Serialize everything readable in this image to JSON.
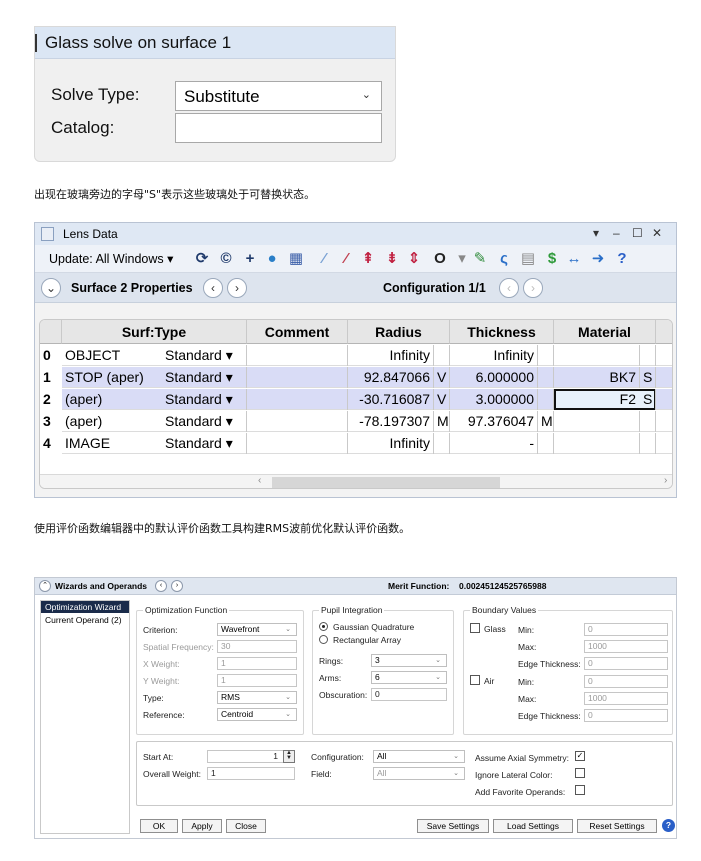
{
  "glass_solve": {
    "title": "Glass solve on surface 1",
    "solve_type_label": "Solve Type:",
    "solve_type_value": "Substitute",
    "catalog_label": "Catalog:",
    "catalog_value": ""
  },
  "caption1": "出现在玻璃旁边的字母\"S\"表示这些玻璃处于可替换状态。",
  "lens_data": {
    "title": "Lens Data",
    "update_label": "Update: All Windows ▾",
    "surface_label": "Surface  2 Properties",
    "config_label": "Configuration 1/1",
    "headers": [
      "Surf:Type",
      "Comment",
      "Radius",
      "Thickness",
      "Material"
    ],
    "rows": [
      {
        "num": "0",
        "name": "OBJECT",
        "type": "Standard ▾",
        "comment": "",
        "radius": "Infinity",
        "rflag": "",
        "thick": "Infinity",
        "tflag": "",
        "mat": "",
        "mflag": ""
      },
      {
        "num": "1",
        "name": "STOP (aper)",
        "type": "Standard ▾",
        "comment": "",
        "radius": "92.847066",
        "rflag": "V",
        "thick": "6.000000",
        "tflag": "",
        "mat": "BK7",
        "mflag": "S"
      },
      {
        "num": "2",
        "name": "(aper)",
        "type": "Standard ▾",
        "comment": "",
        "radius": "-30.716087",
        "rflag": "V",
        "thick": "3.000000",
        "tflag": "",
        "mat": "F2",
        "mflag": "S"
      },
      {
        "num": "3",
        "name": "(aper)",
        "type": "Standard ▾",
        "comment": "",
        "radius": "-78.197307",
        "rflag": "M",
        "thick": "97.376047",
        "tflag": "M",
        "mat": "",
        "mflag": ""
      },
      {
        "num": "4",
        "name": "IMAGE",
        "type": "Standard ▾",
        "comment": "",
        "radius": "Infinity",
        "rflag": "",
        "thick": "-",
        "tflag": "",
        "mat": "",
        "mflag": ""
      }
    ]
  },
  "caption2": "使用评价函数编辑器中的默认评价函数工具构建RMS波前优化默认评价函数。",
  "wizard": {
    "title": "Wizards and Operands",
    "merit_label": "Merit Function:",
    "merit_value": "0.00245124525765988",
    "sidebar": [
      "Optimization Wizard",
      "Current Operand (2)"
    ],
    "opt_func": {
      "title": "Optimization Function",
      "criterion_label": "Criterion:",
      "criterion": "Wavefront",
      "spatial_label": "Spatial Frequency:",
      "spatial": "30",
      "xw_label": "X Weight:",
      "xw": "1",
      "yw_label": "Y Weight:",
      "yw": "1",
      "type_label": "Type:",
      "type": "RMS",
      "ref_label": "Reference:",
      "ref": "Centroid"
    },
    "pupil": {
      "title": "Pupil Integration",
      "gq": "Gaussian Quadrature",
      "ra": "Rectangular Array",
      "rings_label": "Rings:",
      "rings": "3",
      "arms_label": "Arms:",
      "arms": "6",
      "obs_label": "Obscuration:",
      "obs": "0"
    },
    "boundary": {
      "title": "Boundary Values",
      "glass": "Glass",
      "air": "Air",
      "min_label": "Min:",
      "max_label": "Max:",
      "edge_label": "Edge Thickness:",
      "g_min": "0",
      "g_max": "1000",
      "g_edge": "0",
      "a_min": "0",
      "a_max": "1000",
      "a_edge": "0"
    },
    "bottom": {
      "start_label": "Start At:",
      "start": "1",
      "weight_label": "Overall Weight:",
      "weight": "1",
      "config_label": "Configuration:",
      "config": "All",
      "field_label": "Field:",
      "field": "All",
      "axial": "Assume Axial Symmetry:",
      "lateral": "Ignore Lateral Color:",
      "favorite": "Add Favorite Operands:"
    },
    "buttons": {
      "ok": "OK",
      "apply": "Apply",
      "close": "Close",
      "save": "Save Settings",
      "load": "Load Settings",
      "reset": "Reset Settings"
    }
  }
}
